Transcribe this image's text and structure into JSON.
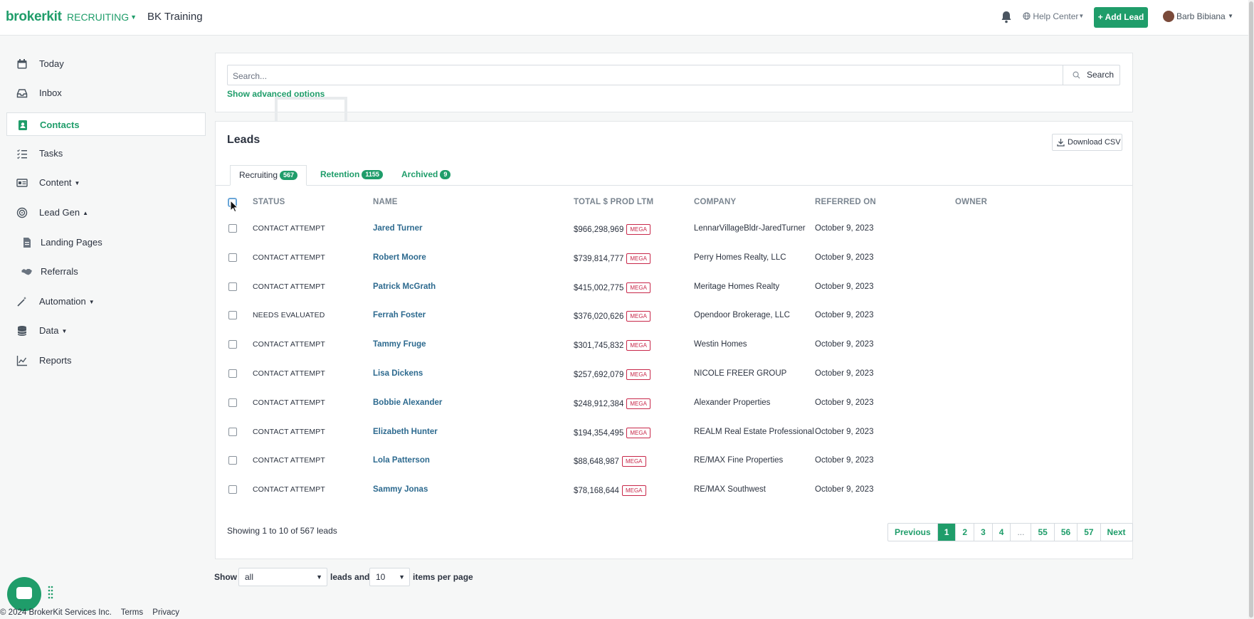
{
  "header": {
    "logo": "brokerkit",
    "module": "RECRUITING",
    "org_name": "BK Training",
    "help_label": "Help Center",
    "add_lead_label": "+ Add Lead",
    "user_name": "Barb Bibiana"
  },
  "sidebar": {
    "items": [
      {
        "label": "Today",
        "icon": "calendar-icon"
      },
      {
        "label": "Inbox",
        "icon": "inbox-icon"
      },
      {
        "label": "Contacts",
        "icon": "contacts-icon",
        "active": true
      },
      {
        "label": "Tasks",
        "icon": "tasks-icon"
      },
      {
        "label": "Content",
        "icon": "content-icon",
        "caret": "down"
      },
      {
        "label": "Lead Gen",
        "icon": "lead-gen-icon",
        "caret": "up"
      },
      {
        "label": "Landing Pages",
        "icon": "file-icon",
        "sub": true
      },
      {
        "label": "Referrals",
        "icon": "handshake-icon",
        "sub": true
      },
      {
        "label": "Automation",
        "icon": "magic-wand-icon",
        "caret": "down"
      },
      {
        "label": "Data",
        "icon": "database-icon",
        "caret": "down"
      },
      {
        "label": "Reports",
        "icon": "chart-icon"
      }
    ]
  },
  "search": {
    "placeholder": "Search...",
    "button_label": "Search",
    "advanced_link": "Show advanced options"
  },
  "leads": {
    "title": "Leads",
    "download_label": "Download CSV",
    "tabs": [
      {
        "label": "Recruiting",
        "count": "567",
        "active": true
      },
      {
        "label": "Retention",
        "count": "1155"
      },
      {
        "label": "Archived",
        "count": "9"
      }
    ],
    "columns": [
      "STATUS",
      "NAME",
      "TOTAL $ PROD LTM",
      "COMPANY",
      "REFERRED ON",
      "OWNER"
    ],
    "mega_label": "MEGA",
    "rows": [
      {
        "status": "CONTACT ATTEMPT",
        "name": "Jared Turner",
        "prod": "$966,298,969",
        "company": "LennarVillageBldr-JaredTurner",
        "referred": "October 9, 2023"
      },
      {
        "status": "CONTACT ATTEMPT",
        "name": "Robert Moore",
        "prod": "$739,814,777",
        "company": "Perry Homes Realty, LLC",
        "referred": "October 9, 2023"
      },
      {
        "status": "CONTACT ATTEMPT",
        "name": "Patrick McGrath",
        "prod": "$415,002,775",
        "company": "Meritage Homes Realty",
        "referred": "October 9, 2023"
      },
      {
        "status": "NEEDS EVALUATED",
        "name": "Ferrah Foster",
        "prod": "$376,020,626",
        "company": "Opendoor Brokerage, LLC",
        "referred": "October 9, 2023"
      },
      {
        "status": "CONTACT ATTEMPT",
        "name": "Tammy Fruge",
        "prod": "$301,745,832",
        "company": "Westin Homes",
        "referred": "October 9, 2023"
      },
      {
        "status": "CONTACT ATTEMPT",
        "name": "Lisa Dickens",
        "prod": "$257,692,079",
        "company": "NICOLE FREER GROUP",
        "referred": "October 9, 2023"
      },
      {
        "status": "CONTACT ATTEMPT",
        "name": "Bobbie Alexander",
        "prod": "$248,912,384",
        "company": "Alexander Properties",
        "referred": "October 9, 2023"
      },
      {
        "status": "CONTACT ATTEMPT",
        "name": "Elizabeth Hunter",
        "prod": "$194,354,495",
        "company": "REALM Real Estate Professional",
        "referred": "October 9, 2023"
      },
      {
        "status": "CONTACT ATTEMPT",
        "name": "Lola Patterson",
        "prod": "$88,648,987",
        "company": "RE/MAX Fine Properties",
        "referred": "October 9, 2023"
      },
      {
        "status": "CONTACT ATTEMPT",
        "name": "Sammy Jonas",
        "prod": "$78,168,644",
        "company": "RE/MAX Southwest",
        "referred": "October 9, 2023"
      }
    ],
    "showing_text": "Showing 1 to 10 of 567 leads",
    "pagination": [
      "Previous",
      "1",
      "2",
      "3",
      "4",
      "...",
      "55",
      "56",
      "57",
      "Next"
    ],
    "active_page": "1"
  },
  "filters": {
    "show_label": "Show",
    "leads_select": "all",
    "leads_and_label": "leads and",
    "per_page_select": "10",
    "per_page_label": "items per page"
  },
  "footer": {
    "copyright": "© 2024 BrokerKit Services Inc.",
    "terms": "Terms",
    "privacy": "Privacy"
  },
  "colors": {
    "brand": "#1f9d6a",
    "mega_badge": "#c8284a",
    "link_name": "#2d6a8f"
  }
}
